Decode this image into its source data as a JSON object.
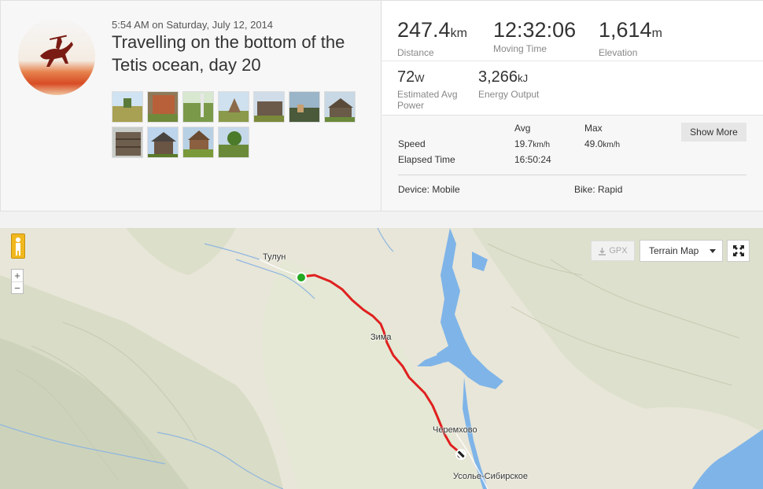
{
  "activity": {
    "timestamp": "5:54 AM on Saturday, July 12, 2014",
    "title": "Travelling on the bottom of the Tetis ocean, day 20"
  },
  "stats": {
    "distance": {
      "value": "247.4",
      "unit": "km",
      "label": "Distance"
    },
    "moving_time": {
      "value": "12:32:06",
      "label": "Moving Time"
    },
    "elevation": {
      "value": "1,614",
      "unit": "m",
      "label": "Elevation"
    },
    "power": {
      "value": "72",
      "unit": "W",
      "label": "Estimated Avg Power"
    },
    "energy": {
      "value": "3,266",
      "unit": "kJ",
      "label": "Energy Output"
    }
  },
  "speed_table": {
    "avg_header": "Avg",
    "max_header": "Max",
    "speed_label": "Speed",
    "speed_avg": "19.7",
    "speed_max": "49.0",
    "speed_unit": "km/h",
    "elapsed_label": "Elapsed Time",
    "elapsed_avg": "16:50:24"
  },
  "show_more_label": "Show More",
  "device": "Device: Mobile",
  "bike": "Bike: Rapid",
  "map": {
    "gpx_label": "GPX",
    "map_type": "Terrain Map",
    "zoom_in": "+",
    "zoom_out": "−",
    "cities": {
      "tulun": "Тулун",
      "zima": "Зима",
      "cheremkhovo": "Черемхово",
      "usolye": "Усолье-Сибирское"
    }
  },
  "colors": {
    "route": "#e02020",
    "start": "#22aa22",
    "water": "#7fb4e8",
    "terrain": "#e7e4d6"
  },
  "icons": [
    "pegman-icon",
    "download-icon",
    "caret-down-icon",
    "fullscreen-icon",
    "start-marker-icon",
    "finish-marker-icon"
  ]
}
